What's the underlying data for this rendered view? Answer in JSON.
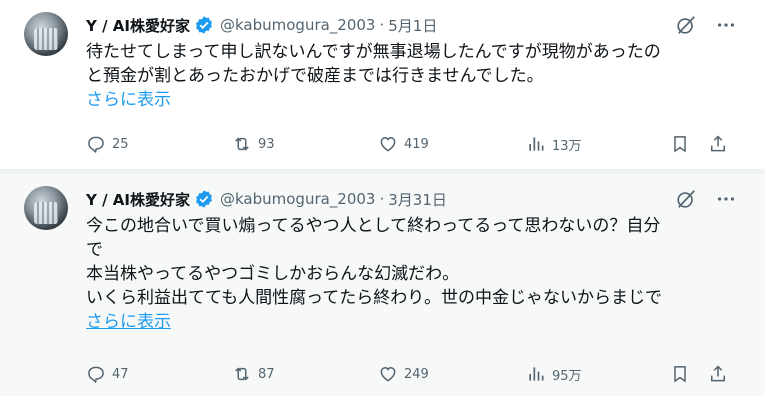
{
  "tweets": [
    {
      "name": "Y / AI株愛好家",
      "handle": "@kabumogura_2003",
      "date": "5月1日",
      "text": "待たせてしまって申し訳ないんですが無事退場したんですが現物があったの\nと預金が割とあったおかげで破産までは行きませんでした。",
      "show_more": "さらに表示",
      "replies": "25",
      "retweets": "93",
      "likes": "419",
      "views": "13万"
    },
    {
      "name": "Y / AI株愛好家",
      "handle": "@kabumogura_2003",
      "date": "3月31日",
      "text": "今この地合いで買い煽ってるやつ人として終わってるって思わないの？自分\nで\n本当株やってるやつゴミしかおらんな幻滅だわ。\nいくら利益出てても人間性腐ってたら終わり。世の中金じゃないからまじで",
      "show_more": "さらに表示",
      "replies": "47",
      "retweets": "87",
      "likes": "249",
      "views": "95万"
    }
  ],
  "separator": "·",
  "colors": {
    "accent": "#1d9bf0",
    "muted": "#536471",
    "text": "#0f1419"
  }
}
